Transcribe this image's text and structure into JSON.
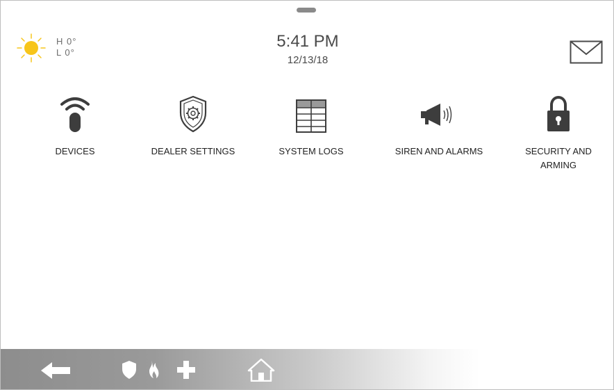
{
  "weather": {
    "icon": "sun-icon",
    "high": "H 0°",
    "low": "L 0°",
    "sun_color": "#f7c51a"
  },
  "clock": {
    "time": "5:41 PM",
    "date": "12/13/18"
  },
  "header": {
    "mail_icon": "mail-icon"
  },
  "tiles": [
    {
      "label": "DEVICES",
      "icon": "wireless-remote-icon"
    },
    {
      "label": "DEALER SETTINGS",
      "icon": "shield-gear-icon"
    },
    {
      "label": "SYSTEM LOGS",
      "icon": "table-log-icon"
    },
    {
      "label": "SIREN AND ALARMS",
      "icon": "megaphone-icon"
    },
    {
      "label": "SECURITY AND ARMING",
      "icon": "padlock-icon"
    }
  ],
  "bottom_bar": {
    "icons": [
      "back-arrow-icon",
      "police-shield-icon",
      "fire-icon",
      "medical-cross-icon",
      "home-icon"
    ],
    "icon_color": "#ffffff"
  }
}
